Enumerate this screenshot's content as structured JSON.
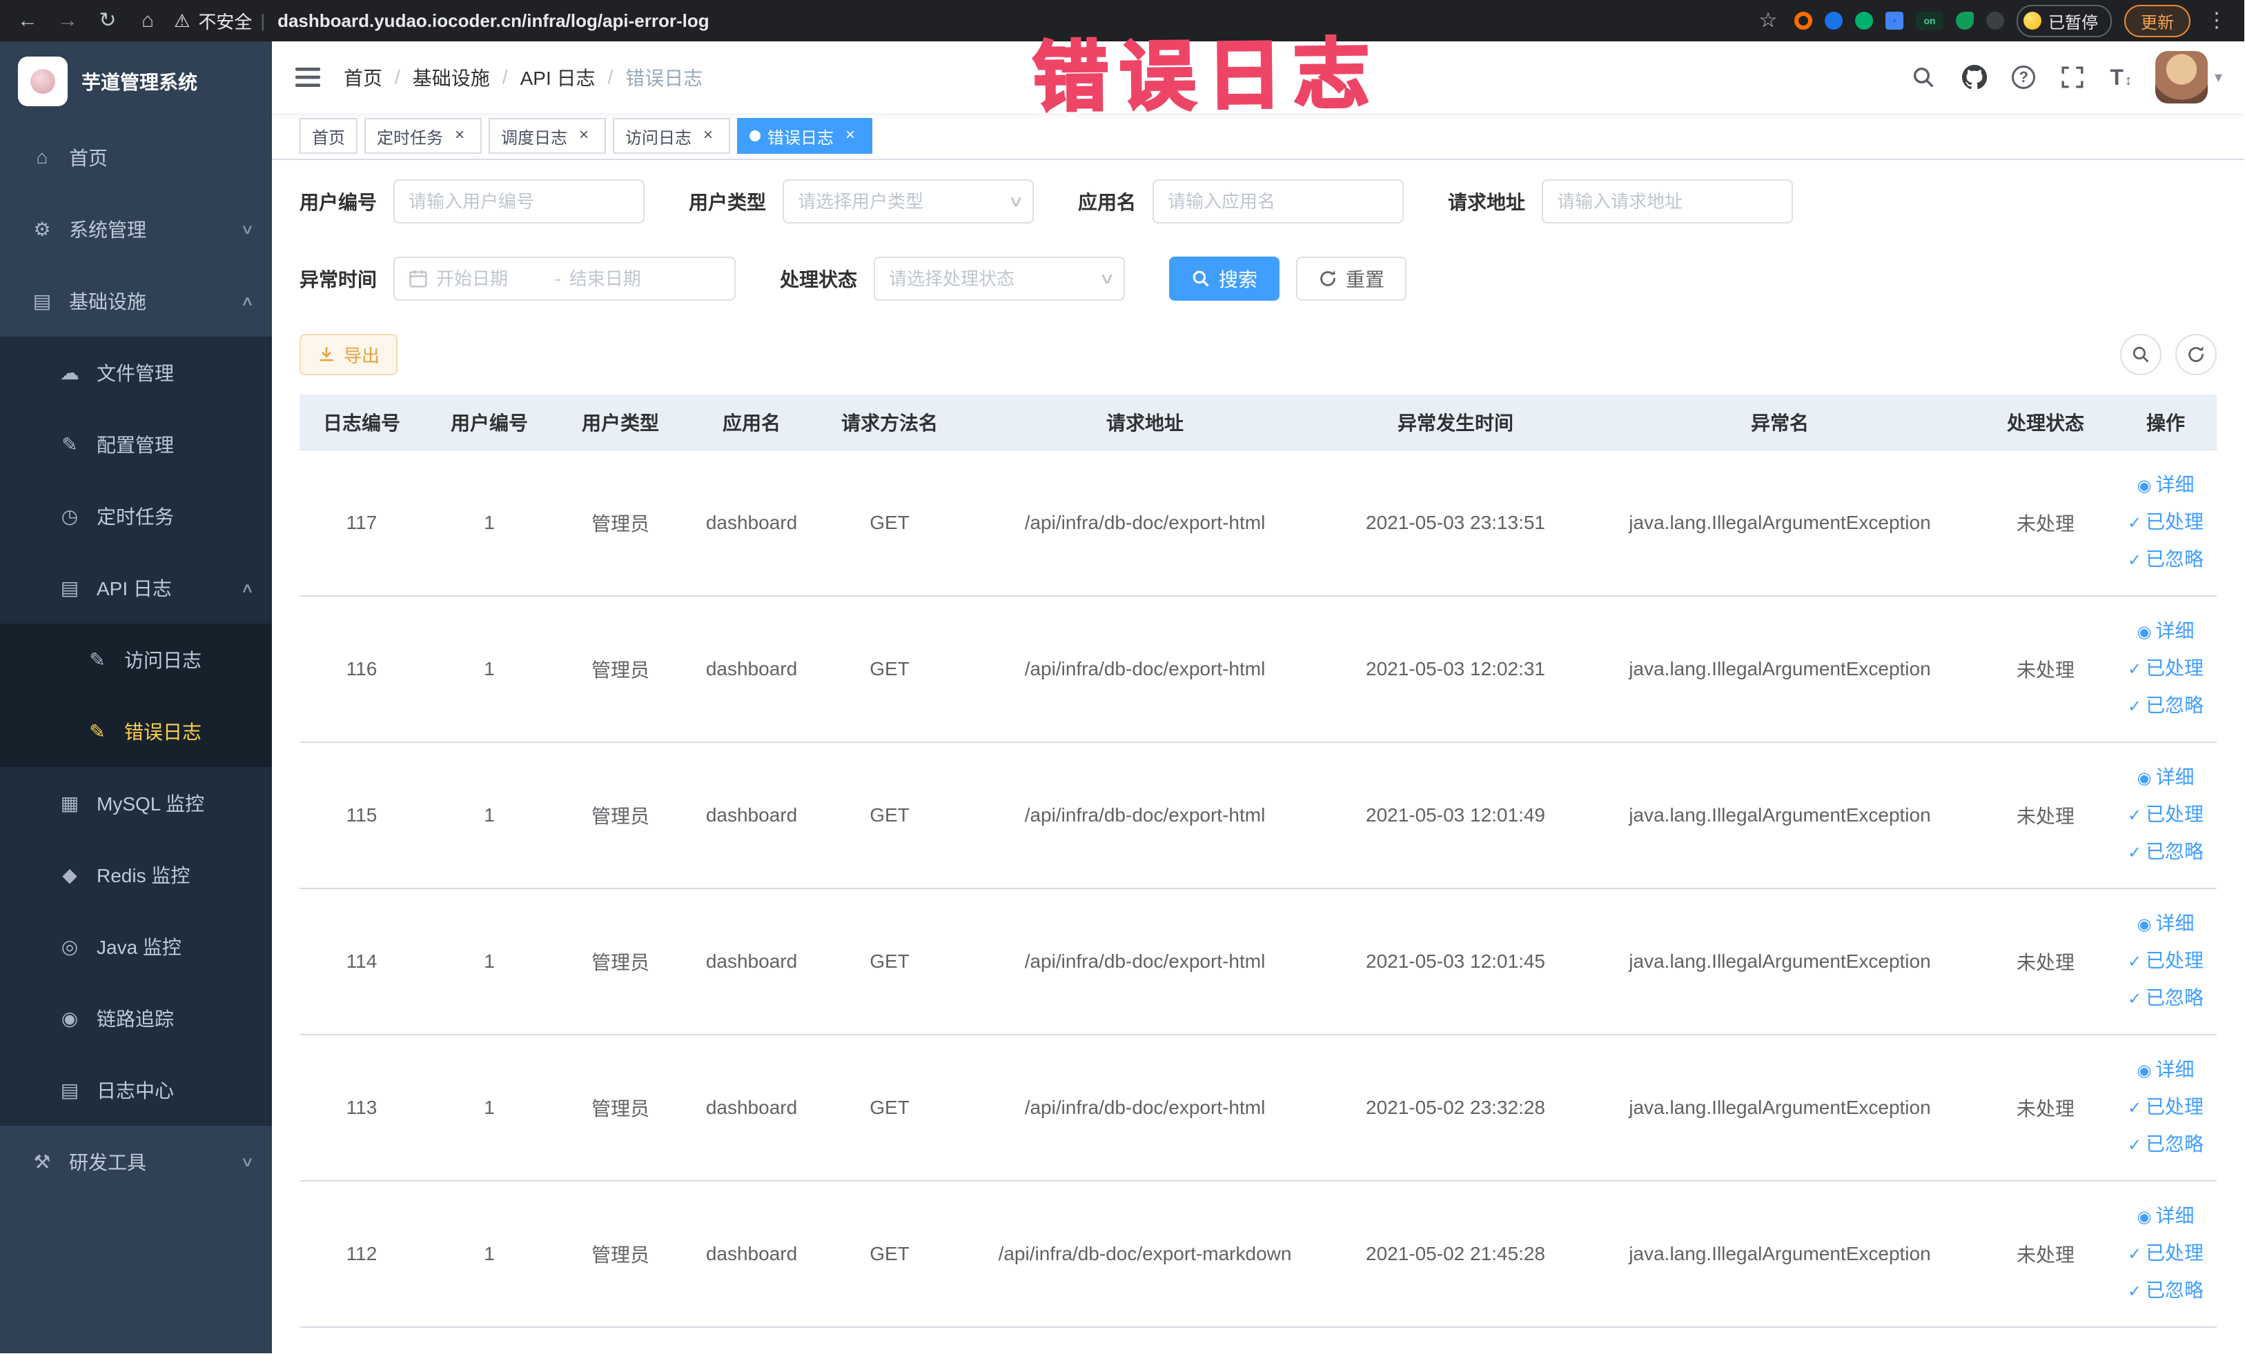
{
  "browser": {
    "security_label": "不安全",
    "url": "dashboard.yudao.iocoder.cn/infra/log/api-error-log",
    "extension_on_label": "on",
    "paused_badge": "已暂停",
    "update_button": "更新"
  },
  "annotation": "错误日志",
  "sidebar": {
    "logo_title": "芋道管理系统",
    "items": [
      {
        "label": "首页"
      },
      {
        "label": "系统管理"
      },
      {
        "label": "基础设施"
      },
      {
        "label": "文件管理"
      },
      {
        "label": "配置管理"
      },
      {
        "label": "定时任务"
      },
      {
        "label": "API 日志"
      },
      {
        "label": "访问日志"
      },
      {
        "label": "错误日志"
      },
      {
        "label": "MySQL 监控"
      },
      {
        "label": "Redis 监控"
      },
      {
        "label": "Java 监控"
      },
      {
        "label": "链路追踪"
      },
      {
        "label": "日志中心"
      },
      {
        "label": "研发工具"
      }
    ]
  },
  "breadcrumb": {
    "separator": "/",
    "items": [
      "首页",
      "基础设施",
      "API 日志",
      "错误日志"
    ]
  },
  "tabs": [
    {
      "label": "首页"
    },
    {
      "label": "定时任务"
    },
    {
      "label": "调度日志"
    },
    {
      "label": "访问日志"
    },
    {
      "label": "错误日志"
    }
  ],
  "filters": {
    "user_id": {
      "label": "用户编号",
      "placeholder": "请输入用户编号"
    },
    "user_type": {
      "label": "用户类型",
      "placeholder": "请选择用户类型"
    },
    "app_name": {
      "label": "应用名",
      "placeholder": "请输入应用名"
    },
    "request_url": {
      "label": "请求地址",
      "placeholder": "请输入请求地址"
    },
    "exception_time": {
      "label": "异常时间",
      "start_placeholder": "开始日期",
      "separator": "-",
      "end_placeholder": "结束日期"
    },
    "process_status": {
      "label": "处理状态",
      "placeholder": "请选择处理状态"
    },
    "search_label": "搜索",
    "reset_label": "重置"
  },
  "toolbar": {
    "export_label": "导出"
  },
  "table": {
    "headers": [
      "日志编号",
      "用户编号",
      "用户类型",
      "应用名",
      "请求方法名",
      "请求地址",
      "异常发生时间",
      "异常名",
      "处理状态",
      "操作"
    ],
    "actions": {
      "detail": "详细",
      "processed": "已处理",
      "ignored": "已忽略"
    },
    "rows": [
      {
        "id": "117",
        "user_id": "1",
        "user_type": "管理员",
        "app": "dashboard",
        "method": "GET",
        "url": "/api/infra/db-doc/export-html",
        "time": "2021-05-03 23:13:51",
        "exception": "java.lang.IllegalArgumentException",
        "status": "未处理"
      },
      {
        "id": "116",
        "user_id": "1",
        "user_type": "管理员",
        "app": "dashboard",
        "method": "GET",
        "url": "/api/infra/db-doc/export-html",
        "time": "2021-05-03 12:02:31",
        "exception": "java.lang.IllegalArgumentException",
        "status": "未处理"
      },
      {
        "id": "115",
        "user_id": "1",
        "user_type": "管理员",
        "app": "dashboard",
        "method": "GET",
        "url": "/api/infra/db-doc/export-html",
        "time": "2021-05-03 12:01:49",
        "exception": "java.lang.IllegalArgumentException",
        "status": "未处理"
      },
      {
        "id": "114",
        "user_id": "1",
        "user_type": "管理员",
        "app": "dashboard",
        "method": "GET",
        "url": "/api/infra/db-doc/export-html",
        "time": "2021-05-03 12:01:45",
        "exception": "java.lang.IllegalArgumentException",
        "status": "未处理"
      },
      {
        "id": "113",
        "user_id": "1",
        "user_type": "管理员",
        "app": "dashboard",
        "method": "GET",
        "url": "/api/infra/db-doc/export-html",
        "time": "2021-05-02 23:32:28",
        "exception": "java.lang.IllegalArgumentException",
        "status": "未处理"
      },
      {
        "id": "112",
        "user_id": "1",
        "user_type": "管理员",
        "app": "dashboard",
        "method": "GET",
        "url": "/api/infra/db-doc/export-markdown",
        "time": "2021-05-02 21:45:28",
        "exception": "java.lang.IllegalArgumentException",
        "status": "未处理"
      }
    ]
  },
  "colors": {
    "accent": "#409eff",
    "sidebar_bg": "#304156",
    "active_menu": "#ffd04b",
    "annotation": "#ee4566",
    "warning_btn": "#e6a23c"
  },
  "icons": {
    "back": "←",
    "forward": "→",
    "reload": "↻",
    "home": "⌂",
    "warning": "⚠",
    "divider": "|",
    "star": "☆",
    "kebab": "⋮",
    "question": "?",
    "text_size": "T",
    "updown": "↕",
    "caret_down": "▾",
    "chevron_up": "∧",
    "chevron_down": "∨",
    "select_arrow": "∨",
    "tab_close": "×",
    "detail": "◉",
    "check": "✓",
    "menu_home": "⌂",
    "menu_system": "⚙",
    "menu_infra": "▤",
    "menu_file": "☁",
    "menu_config": "✎",
    "menu_task": "◷",
    "menu_api": "▤",
    "menu_doc": "✎",
    "menu_mysql": "▦",
    "menu_redis": "◆",
    "menu_java": "◎",
    "menu_trace": "◉",
    "menu_log": "▤",
    "menu_tools": "⚒"
  }
}
